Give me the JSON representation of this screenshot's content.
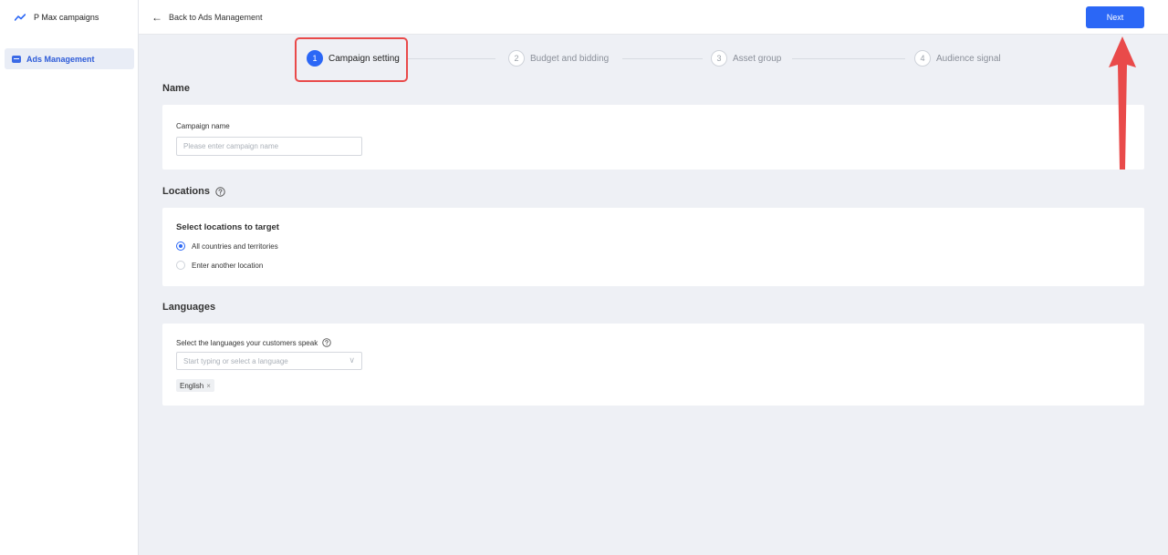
{
  "sidebar": {
    "brand": "P Max campaigns",
    "items": [
      {
        "label": "Ads Management"
      }
    ]
  },
  "topbar": {
    "back_label": "Back to Ads Management",
    "next_label": "Next"
  },
  "steps": [
    {
      "num": "1",
      "label": "Campaign setting",
      "active": true
    },
    {
      "num": "2",
      "label": "Budget and bidding"
    },
    {
      "num": "3",
      "label": "Asset group"
    },
    {
      "num": "4",
      "label": "Audience signal"
    }
  ],
  "name_section": {
    "title": "Name",
    "campaign_name_label": "Campaign name",
    "campaign_name_placeholder": "Please enter campaign name",
    "campaign_name_value": ""
  },
  "locations_section": {
    "title": "Locations",
    "subtitle": "Select locations to target",
    "options": [
      {
        "label": "All countries and territories",
        "checked": true
      },
      {
        "label": "Enter another location",
        "checked": false
      }
    ]
  },
  "languages_section": {
    "title": "Languages",
    "label": "Select the languages your customers speak",
    "placeholder": "Start typing or select a language",
    "selected": [
      {
        "label": "English"
      }
    ]
  },
  "colors": {
    "accent": "#2b67f6",
    "annotation": "#e94a4a"
  },
  "icons": {
    "brand": "trend-line-icon",
    "back": "arrow-left-icon",
    "help": "question-circle-icon",
    "select": "chevron-down-icon",
    "tag_remove": "close-icon"
  }
}
